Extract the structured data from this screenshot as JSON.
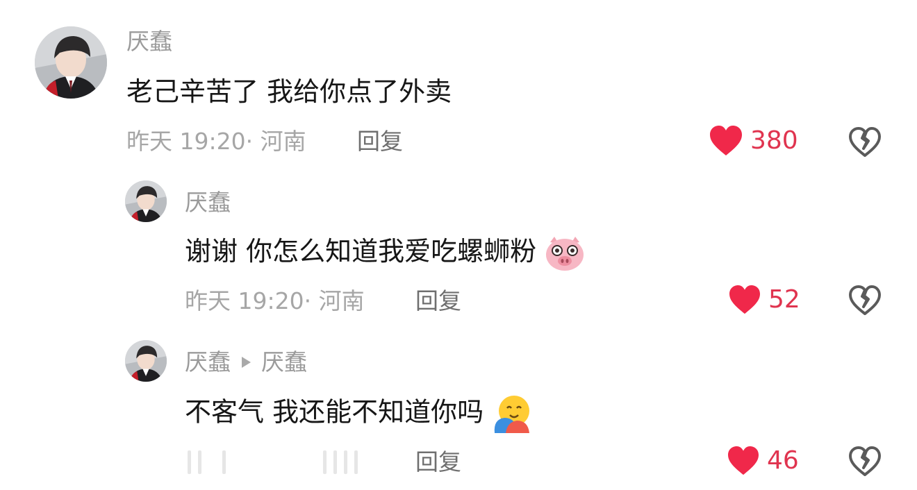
{
  "comments": [
    {
      "username": "厌蠢",
      "content": "老己辛苦了 我给你点了外卖",
      "time": "昨天 19:20",
      "location": "河南",
      "reply_label": "回复",
      "likes": "380"
    },
    {
      "username": "厌蠢",
      "content": "谢谢 你怎么知道我爱吃螺蛳粉",
      "content_emoji": "pig-face-emoji",
      "time": "昨天 19:20",
      "location": "河南",
      "reply_label": "回复",
      "likes": "52"
    },
    {
      "username": "厌蠢",
      "reply_to": "厌蠢",
      "content": "不客气 我还能不知道你吗",
      "content_emoji": "hugging-face-emoji",
      "reply_label": "回复",
      "likes": "46"
    }
  ],
  "colors": {
    "like": "#e0344f",
    "username": "#9b9b9b",
    "meta": "#a6a6a6",
    "text": "#161616"
  }
}
